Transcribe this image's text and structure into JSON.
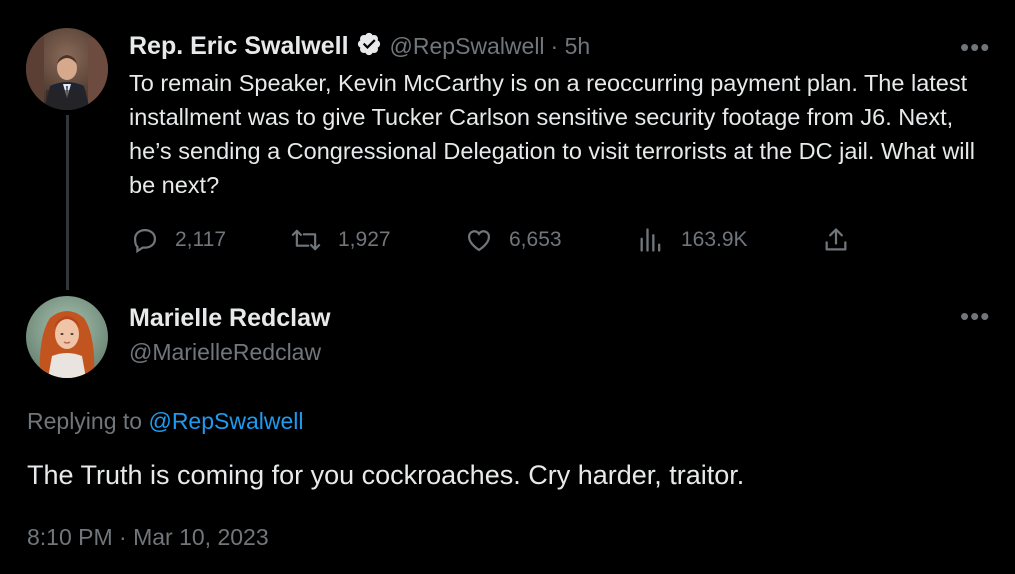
{
  "tweet": {
    "author_name": "Rep. Eric Swalwell",
    "handle": "@RepSwalwell",
    "time": "· 5h",
    "text": "To remain Speaker, Kevin McCarthy is on a reoccurring payment plan. The latest installment was to give Tucker Carlson sensitive security footage from J6. Next, he’s sending a Congressional Delegation to visit terrorists at the DC jail. What will be next?",
    "replies": "2,117",
    "retweets": "1,927",
    "likes": "6,653",
    "views": "163.9K"
  },
  "reply": {
    "author_name": "Marielle Redclaw",
    "handle": "@MarielleRedclaw",
    "replying_prefix": "Replying to",
    "replying_to": "@RepSwalwell",
    "text": "The Truth is coming for you cockroaches. Cry harder, traitor.",
    "timestamp": "8:10 PM · Mar 10, 2023"
  },
  "more_glyph": "•••",
  "colors": {
    "background": "#000000",
    "text": "#e7e9ea",
    "muted": "#71767b",
    "link": "#1d9bf0",
    "verified_badge": "#e7e9ea"
  },
  "icons": [
    "verified-badge-icon",
    "reply-icon",
    "retweet-icon",
    "like-icon",
    "views-icon",
    "share-icon",
    "more-icon"
  ]
}
